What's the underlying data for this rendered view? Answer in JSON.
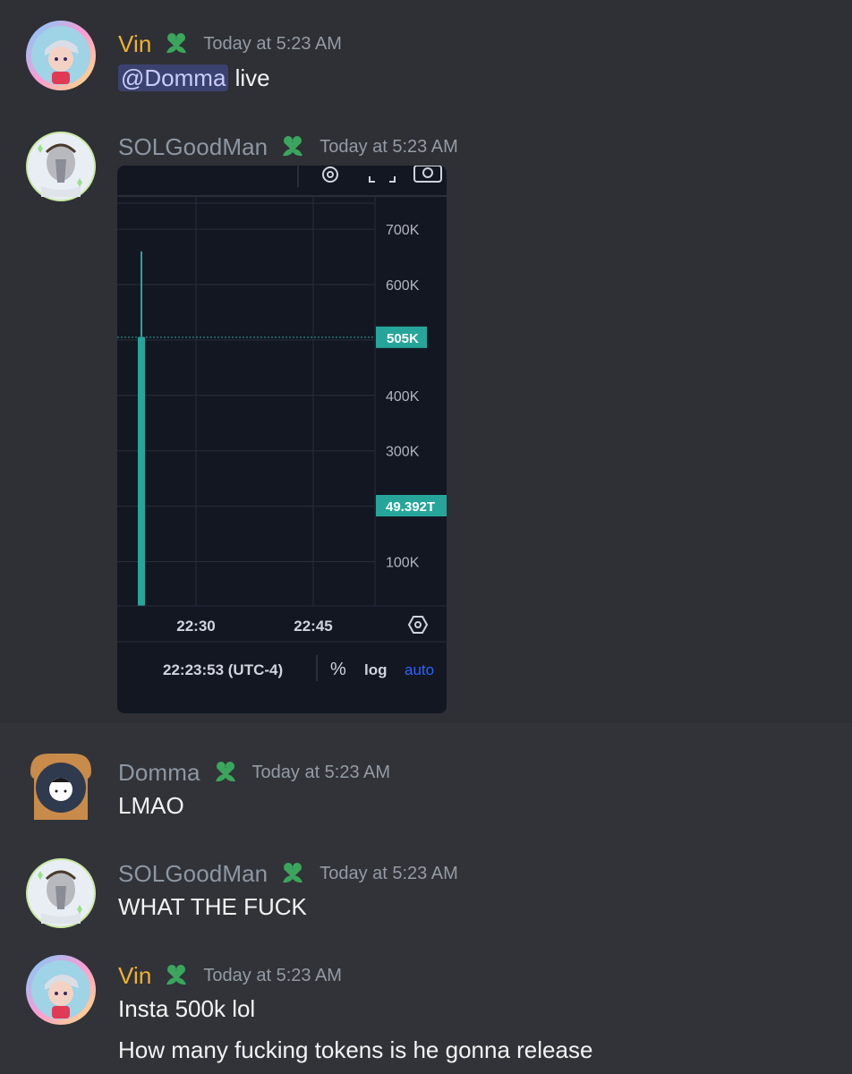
{
  "messages": [
    {
      "author": "Vin",
      "timestamp": "Today at 5:23 AM",
      "mention": "@Domma",
      "text_after_mention": " live"
    },
    {
      "author": "SOLGoodMan",
      "timestamp": "Today at 5:23 AM"
    },
    {
      "author": "Domma",
      "timestamp": "Today at 5:23 AM",
      "text": "LMAO"
    },
    {
      "author": "SOLGoodMan",
      "timestamp": "Today at 5:23 AM",
      "text": "WHAT THE FUCK"
    },
    {
      "author": "Vin",
      "timestamp": "Today at 5:23 AM",
      "lines": [
        "Insta 500k lol",
        "How many fucking tokens is he gonna release"
      ]
    }
  ],
  "chart_data": {
    "type": "bar",
    "title": "",
    "y_ticks": [
      "700K",
      "600K",
      "300K",
      "400K",
      "100K"
    ],
    "y_tick_values": [
      700000,
      600000,
      300000,
      400000,
      100000
    ],
    "x_ticks": [
      "22:30",
      "22:45"
    ],
    "current_price_label": "505K",
    "current_price_value": 505000,
    "volume_label": "49.392T",
    "candle": {
      "high": 660000,
      "close": 505000,
      "open": 0
    },
    "ylim": [
      20000,
      760000
    ],
    "time_display": "22:23:53 (UTC-4)",
    "percent_label": "%",
    "log_label": "log",
    "auto_label": "auto",
    "colors": {
      "background": "#131722",
      "up": "#26a69a",
      "grid": "#2a2e39",
      "auto": "#2962ff"
    }
  },
  "colors": {
    "vin_name": "#f0b232",
    "grey_name": "#8d97a3",
    "badge": "#3ba55d"
  },
  "icons": [
    "gear-icon",
    "fullscreen-icon",
    "camera-icon",
    "settings-hex-icon",
    "heart-badge-icon"
  ]
}
